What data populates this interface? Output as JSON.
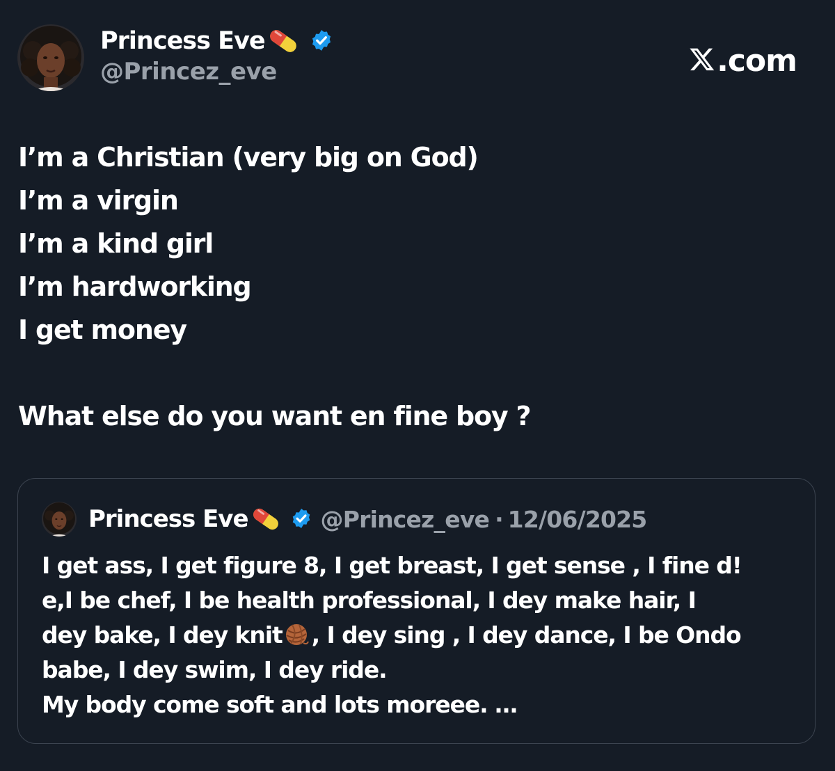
{
  "author": {
    "display_name": "Princess Eve",
    "name_emoji": "pill-emoji",
    "verified": true,
    "handle": "@Princez_eve"
  },
  "brand": {
    "text": ".com",
    "icon": "x-logo-icon"
  },
  "tweet": {
    "lines": [
      "I’m a Christian (very big on God)",
      "I’m a virgin",
      "I’m a kind girl",
      "I’m hardworking",
      "I get money",
      "What else do you want en fine boy ?"
    ]
  },
  "quoted_tweet": {
    "display_name": "Princess Eve",
    "name_emoji": "pill-emoji",
    "verified": true,
    "handle": "@Princez_eve",
    "separator": "·",
    "date": "12/06/2025",
    "lines": [
      "I get ass, I get figure 8, I get breast, I  get sense , I  fine d!",
      "e,I be chef, I be health professional, I dey make hair, I",
      "dey bake, I dey knit",
      ", I dey sing , I dey dance, I be Ondo",
      "babe, I dey swim, I dey ride.",
      "My body come soft and lots moreee. …"
    ],
    "inline_emoji": "yarn-emoji"
  },
  "colors": {
    "background": "#151c26",
    "text_primary": "#ffffff",
    "text_secondary": "#9aa1aa",
    "verified_blue": "#1d9bf0",
    "card_border": "#3c4450"
  }
}
